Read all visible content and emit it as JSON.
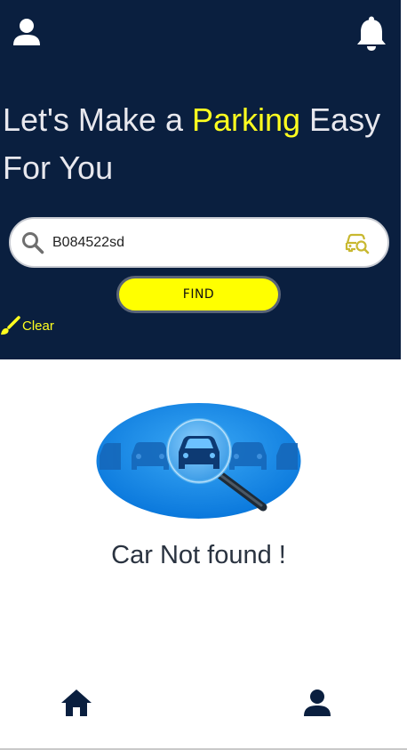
{
  "header": {
    "headline_before": "Let's Make a ",
    "headline_accent": "Parking",
    "headline_after": " Easy For You",
    "top_left_icon": "user-icon",
    "top_right_icon": "bell-icon"
  },
  "search": {
    "value": "B084522sd",
    "placeholder": "",
    "left_icon": "search-icon",
    "right_icon": "car-search-icon"
  },
  "find_button": {
    "label": "FIND"
  },
  "clear": {
    "icon": "brush-icon",
    "label": "Clear"
  },
  "result": {
    "illustration": "car-search-illustration",
    "message": "Car Not found !"
  },
  "bottom_nav": {
    "items": [
      {
        "icon": "home-icon"
      },
      {
        "icon": "user-icon"
      }
    ]
  },
  "colors": {
    "header_bg": "#0a1f3f",
    "accent_yellow": "#ffff1f",
    "find_button_bg": "#ffff00",
    "icon_navy": "#0a1f3f",
    "text_dark": "#2a3340",
    "illustration_blue": "#1a8fe8"
  }
}
